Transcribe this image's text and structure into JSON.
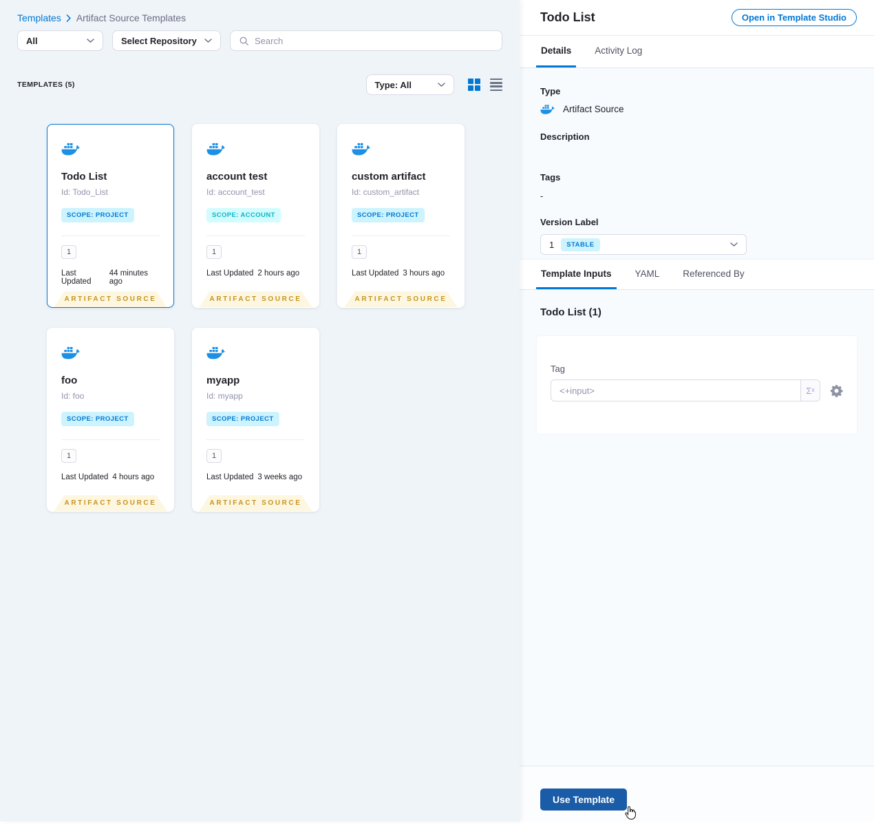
{
  "breadcrumb": {
    "root": "Templates",
    "current": "Artifact Source Templates"
  },
  "filters": {
    "scope": "All",
    "repository": "Select Repository",
    "search_placeholder": "Search"
  },
  "list_header": {
    "count": "TEMPLATES (5)",
    "type_filter": "Type: All"
  },
  "cards": [
    {
      "title": "Todo List",
      "id": "Id: Todo_List",
      "scope_badge": "SCOPE: PROJECT",
      "version_count": "1",
      "last_updated_label": "Last Updated",
      "last_updated_value": "44 minutes ago",
      "type_ribbon": "ARTIFACT SOURCE",
      "selected": true
    },
    {
      "title": "account test",
      "id": "Id: account_test",
      "scope_badge": "SCOPE: ACCOUNT",
      "version_count": "1",
      "last_updated_label": "Last Updated",
      "last_updated_value": "2 hours ago",
      "type_ribbon": "ARTIFACT SOURCE",
      "selected": false
    },
    {
      "title": "custom artifact",
      "id": "Id: custom_artifact",
      "scope_badge": "SCOPE: PROJECT",
      "version_count": "1",
      "last_updated_label": "Last Updated",
      "last_updated_value": "3 hours ago",
      "type_ribbon": "ARTIFACT SOURCE",
      "selected": false
    },
    {
      "title": "foo",
      "id": "Id: foo",
      "scope_badge": "SCOPE: PROJECT",
      "version_count": "1",
      "last_updated_label": "Last Updated",
      "last_updated_value": "4 hours ago",
      "type_ribbon": "ARTIFACT SOURCE",
      "selected": false
    },
    {
      "title": "myapp",
      "id": "Id: myapp",
      "scope_badge": "SCOPE: PROJECT",
      "version_count": "1",
      "last_updated_label": "Last Updated",
      "last_updated_value": "3 weeks ago",
      "type_ribbon": "ARTIFACT SOURCE",
      "selected": false
    }
  ],
  "panel": {
    "title": "Todo List",
    "open_studio": "Open in Template Studio",
    "tabs": {
      "details": "Details",
      "activity_log": "Activity Log"
    },
    "details": {
      "type_label": "Type",
      "type_value": "Artifact Source",
      "description_label": "Description",
      "tags_label": "Tags",
      "tags_value": "-",
      "version_label": "Version Label",
      "version_value": "1",
      "version_badge": "STABLE"
    },
    "inner_tabs": {
      "template_inputs": "Template Inputs",
      "yaml": "YAML",
      "referenced_by": "Referenced By"
    },
    "inputs": {
      "title": "Todo List (1)",
      "tag_label": "Tag",
      "tag_value": "<+input>",
      "expression_toggle": "Σˣ"
    },
    "footer": {
      "use_template": "Use Template"
    }
  },
  "colors": {
    "accent_blue": "#0278d5",
    "docker_blue": "#1d90e6",
    "scope_project_bg": "#cdf4fe",
    "scope_account_bg": "#d3fcfe",
    "scope_account_text": "#0ab5c9",
    "ribbon_bg": "#fdf7e2",
    "ribbon_text": "#c8931c",
    "use_template_bg": "#1a5ca8"
  }
}
